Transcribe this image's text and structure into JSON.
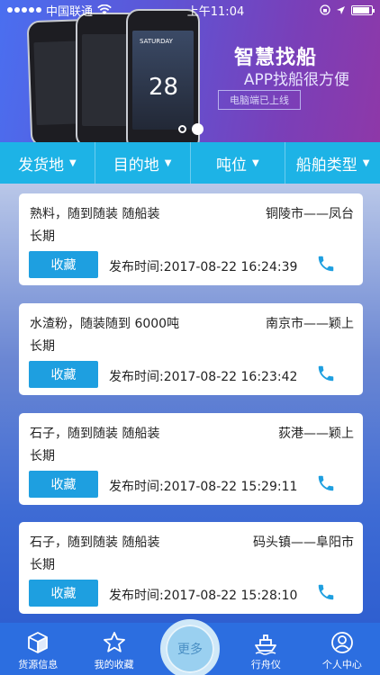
{
  "status_bar": {
    "carrier": "中国联通",
    "time": "上午11:04"
  },
  "banner": {
    "title": "智慧找船",
    "subtitle": "APP找船很方便",
    "button": "电脑端已上线",
    "weather_label": "SATURDAY",
    "weather_temp": "28"
  },
  "filters": [
    {
      "label": "发货地"
    },
    {
      "label": "目的地"
    },
    {
      "label": "吨位"
    },
    {
      "label": "船舶类型"
    }
  ],
  "cards": [
    {
      "desc": "熟料，随到随装 随船装",
      "route": "铜陵市——凤台",
      "period": "长期",
      "fav": "收藏",
      "time": "发布时间:2017-08-22 16:24:39"
    },
    {
      "desc": "水渣粉，随装随到 6000吨",
      "route": "南京市——颖上",
      "period": "长期",
      "fav": "收藏",
      "time": "发布时间:2017-08-22 16:23:42"
    },
    {
      "desc": "石子，随到随装 随船装",
      "route": "荻港——颖上",
      "period": "长期",
      "fav": "收藏",
      "time": "发布时间:2017-08-22 15:29:11"
    },
    {
      "desc": "石子，随到随装 随船装",
      "route": "码头镇——阜阳市",
      "period": "长期",
      "fav": "收藏",
      "time": "发布时间:2017-08-22 15:28:10"
    }
  ],
  "tabs": [
    {
      "label": "货源信息",
      "icon": "cube-icon"
    },
    {
      "label": "我的收藏",
      "icon": "star-icon"
    },
    {
      "label": "更多",
      "icon": "more-icon"
    },
    {
      "label": "行舟仪",
      "icon": "ship-icon"
    },
    {
      "label": "个人中心",
      "icon": "user-icon"
    }
  ],
  "colors": {
    "filter_bar": "#1db3e6",
    "fav_button": "#1e9fe0",
    "tab_bar": "#2c6ee0"
  }
}
